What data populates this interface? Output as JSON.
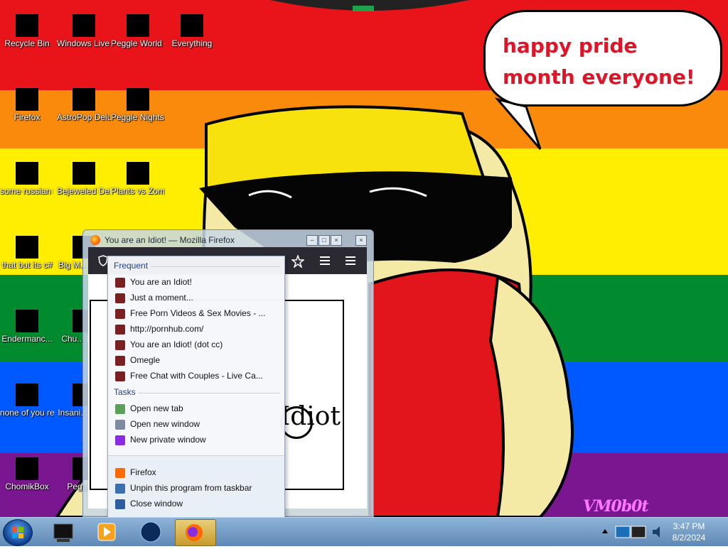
{
  "desktop": {
    "icons": [
      {
        "label": "Recycle Bin",
        "icon": "recycle-bin-icon"
      },
      {
        "label": "Windows Live Mail",
        "icon": "mail-icon"
      },
      {
        "label": "Peggle World of Warcraft ...",
        "icon": "game-icon"
      },
      {
        "label": "Everything",
        "icon": "search-app-icon"
      },
      {
        "label": "Firefox",
        "icon": "firefox-icon"
      },
      {
        "label": "AstroPop Deluxe",
        "icon": "game-icon"
      },
      {
        "label": "Peggle Nights Deluxe",
        "icon": "game-icon"
      },
      {
        "label": "some russian ran a rat",
        "icon": "file-icon"
      },
      {
        "label": "Bejeweled Deluxe",
        "icon": "gem-icon"
      },
      {
        "label": "Plants vs Zombies",
        "icon": "plant-icon"
      },
      {
        "label": "that but its c#",
        "icon": "folder-icon"
      },
      {
        "label": "Big M... Del...",
        "icon": "game-icon"
      },
      {
        "label": "Endermanc...",
        "icon": "terminal-icon"
      },
      {
        "label": "Chu... Del...",
        "icon": "game-icon"
      },
      {
        "label": "none of you retards kno...",
        "icon": "firefox-icon"
      },
      {
        "label": "Insani... Del...",
        "icon": "game-icon"
      },
      {
        "label": "ChomikBox",
        "icon": "hamster-icon"
      },
      {
        "label": "Peggle...",
        "icon": "game-icon"
      }
    ]
  },
  "wallpaper": {
    "bubble_text": "happy pride month everyone!",
    "signature": "VM0b0t"
  },
  "firefox_window": {
    "title": "You are an Idiot! — Mozilla Firefox",
    "page_text": "Idiot"
  },
  "jumplist": {
    "frequent_header": "Frequent",
    "frequent": [
      {
        "label": "You are an Idiot!",
        "icon": "page-icon"
      },
      {
        "label": "Just a moment...",
        "icon": "page-icon"
      },
      {
        "label": "Free Porn Videos & Sex Movies - ...",
        "icon": "page-icon"
      },
      {
        "label": "http://pornhub.com/",
        "icon": "page-icon"
      },
      {
        "label": "You are an Idiot! (dot cc)",
        "icon": "page-icon"
      },
      {
        "label": "Omegle",
        "icon": "page-icon"
      },
      {
        "label": "Free Chat with Couples - Live Ca...",
        "icon": "page-icon"
      }
    ],
    "tasks_header": "Tasks",
    "tasks": [
      {
        "label": "Open new tab",
        "icon": "new-tab-icon"
      },
      {
        "label": "Open new window",
        "icon": "new-window-icon"
      },
      {
        "label": "New private window",
        "icon": "private-window-icon"
      }
    ],
    "bottom": [
      {
        "label": "Firefox",
        "icon": "firefox-icon"
      },
      {
        "label": "Unpin this program from taskbar",
        "icon": "unpin-icon"
      },
      {
        "label": "Close window",
        "icon": "close-icon"
      }
    ]
  },
  "taskbar": {
    "clock_time": "3:47 PM",
    "clock_date": "8/2/2024"
  },
  "colors": {
    "accent": "#e01426",
    "taskbar": "#5e88b5"
  }
}
